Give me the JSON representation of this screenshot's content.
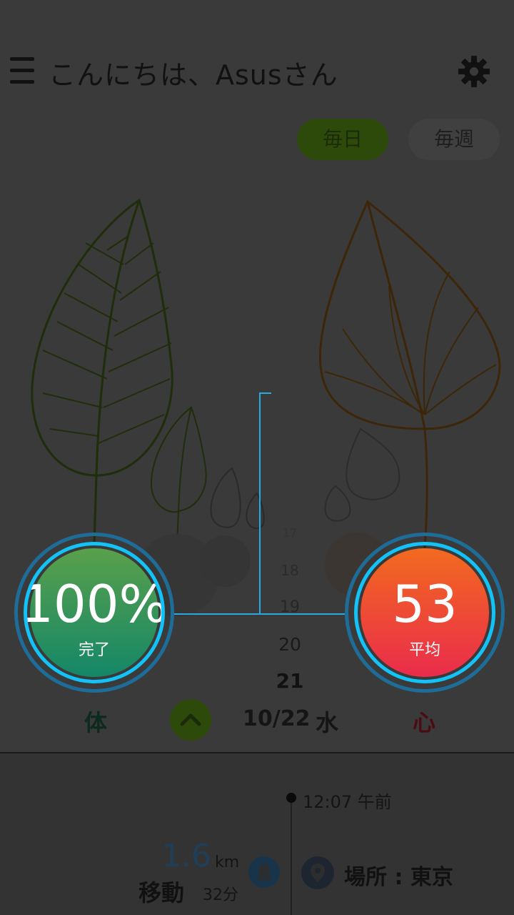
{
  "header": {
    "greeting": "こんにちは、Asusさん"
  },
  "toggle": {
    "daily_label": "毎日",
    "weekly_label": "毎週"
  },
  "body_circle": {
    "value": "100%",
    "label": "完了"
  },
  "heart_circle": {
    "value": "53",
    "label": "平均"
  },
  "timeline": {
    "hours": [
      "17",
      "18",
      "19",
      "20",
      "21"
    ]
  },
  "date_bar": {
    "body_label": "体",
    "date": "10/22",
    "weekday": "水",
    "heart_label": "心"
  },
  "activity": {
    "distance": "1.6",
    "distance_unit": "km",
    "type_label": "移動",
    "duration": "32分",
    "time": "12:07 午前",
    "location": "場所 : 東京"
  },
  "colors": {
    "accent_blue": "#13c2f6",
    "body_green": "#148768",
    "heart_red": "#ea2c4c"
  }
}
